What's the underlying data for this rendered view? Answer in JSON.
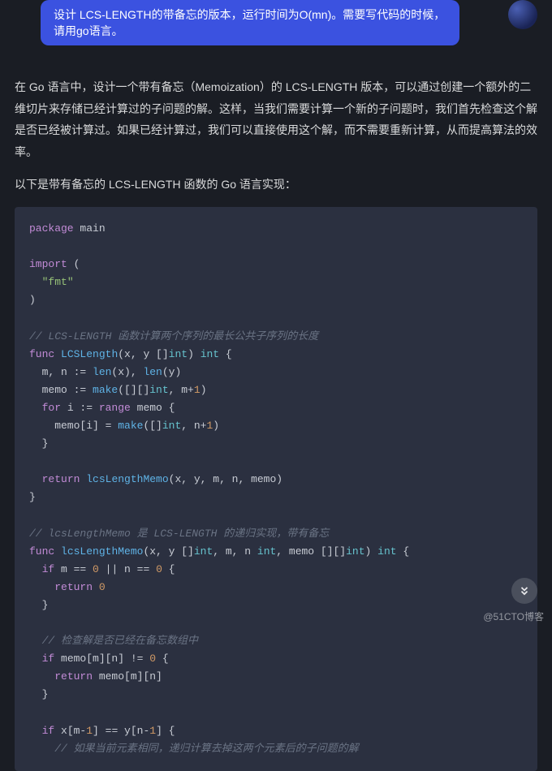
{
  "user_message": {
    "text": "设计 LCS-LENGTH的带备忘的版本，运行时间为O(mn)。需要写代码的时候，请用go语言。"
  },
  "reply": {
    "para1": "在 Go 语言中，设计一个带有备忘（Memoization）的 LCS-LENGTH 版本，可以通过创建一个额外的二维切片来存储已经计算过的子问题的解。这样，当我们需要计算一个新的子问题时，我们首先检查这个解是否已经被计算过。如果已经计算过，我们可以直接使用这个解，而不需要重新计算，从而提高算法的效率。",
    "para2": "以下是带有备忘的 LCS-LENGTH 函数的 Go 语言实现："
  },
  "code": {
    "pkg_kw": "package",
    "pkg_name": "main",
    "import_kw": "import",
    "import_open": " (",
    "import_str": "\"fmt\"",
    "import_close": ")",
    "cmt1": "// LCS-LENGTH 函数计算两个序列的最长公共子序列的长度",
    "func_kw": "func",
    "fn1_name": "LCSLength",
    "fn1_sig_a": "(x, y []",
    "fn1_sig_int": "int",
    "fn1_sig_b": ") ",
    "fn1_ret": "int",
    "fn1_brace": " {",
    "l_mn": "  m, n := ",
    "len_kw": "len",
    "l_mn2": "(x), ",
    "l_mn3": "(y)",
    "l_memo": "  memo := ",
    "make_kw": "make",
    "l_memo2": "([][]",
    "l_memo3": ", m+",
    "one": "1",
    "l_memo4": ")",
    "for_kw": "for",
    "l_for": " i := ",
    "range_kw": "range",
    "l_for2": " memo {",
    "l_make2a": "    memo[i] = ",
    "l_make2b": "([]",
    "l_make2c": ", n+",
    "l_make2d": ")",
    "l_brace_close": "  }",
    "return_kw": "return",
    "l_ret": " ",
    "fn_memo": "lcsLengthMemo",
    "l_ret2": "(x, y, m, n, memo)",
    "l_fnclose": "}",
    "cmt2": "// lcsLengthMemo 是 LCS-LENGTH 的递归实现，带有备忘",
    "fn2_sig_a": "(x, y []",
    "fn2_sig_b": ", m, n ",
    "fn2_sig_c": ", memo [][]",
    "fn2_sig_d": ") ",
    "if_kw": "if",
    "l_if0": " m == ",
    "zero": "0",
    "l_if0b": " || n == ",
    "l_if0c": " {",
    "l_ret0": "    ",
    "cmt3": "// 检查解是否已经在备忘数组中",
    "l_ifmemo": " memo[m][n] != ",
    "l_retmemo": " memo[m][n]",
    "l_ifeq": " x[m-",
    "l_ifeq2": "] == y[n-",
    "l_ifeq3": "] {",
    "cmt4": "// 如果当前元素相同，递归计算去掉这两个元素后的子问题的解"
  },
  "footer": {
    "watermark": "@51CTO博客"
  }
}
